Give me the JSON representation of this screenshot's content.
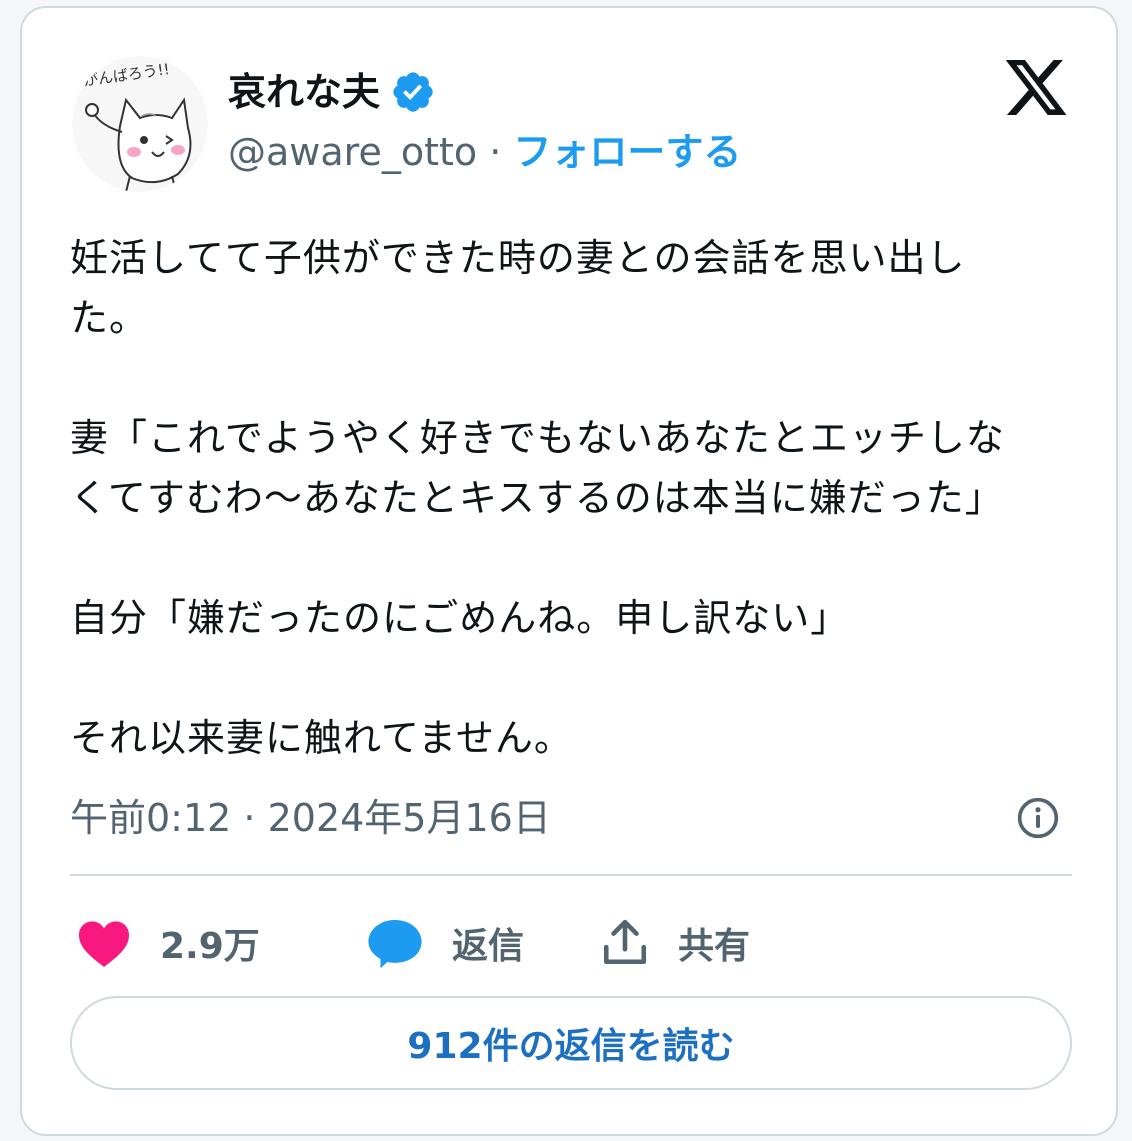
{
  "user": {
    "display_name": "哀れな夫",
    "handle": "@aware_otto",
    "separator": " · ",
    "follow_label": "フォローする",
    "avatar_caption": "がんばろう!!"
  },
  "tweet": {
    "text": "妊活してて子供ができた時の妻との会話を思い出し\nた。\n\n妻「これでようやく好きでもないあなたとエッチしな\nくてすむわ〜あなたとキスするのは本当に嫌だった」\n\n自分「嫌だったのにごめんね。申し訳ない」\n\nそれ以来妻に触れてません。",
    "time": "午前0:12",
    "date_separator": " · ",
    "date": "2024年5月16日"
  },
  "actions": {
    "like_count": "2.9万",
    "reply_label": "返信",
    "share_label": "共有"
  },
  "read_replies_label": "912件の返信を読む",
  "icons": [
    "verified-badge-icon",
    "x-logo-icon",
    "info-icon",
    "heart-icon",
    "reply-bubble-icon",
    "share-icon"
  ],
  "colors": {
    "accent": "#1d9bf0",
    "heart": "#f91880",
    "reply_button_text": "#1d6fc0",
    "muted": "#536471"
  }
}
